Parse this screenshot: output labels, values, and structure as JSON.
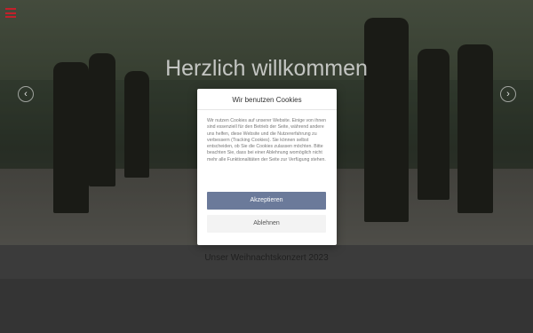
{
  "hero": {
    "title": "Herzlich willkommen",
    "prev_arrow": "‹",
    "next_arrow": "›"
  },
  "section": {
    "title": "Unser Weihnachtskonzert 2023"
  },
  "cookie_dialog": {
    "title": "Wir benutzen Cookies",
    "text": "Wir nutzen Cookies auf unserer Website. Einige von ihnen sind essenziell für den Betrieb der Seite, während andere uns helfen, diese Website und die Nutzererfahrung zu verbessern (Tracking Cookies). Sie können selbst entscheiden, ob Sie die Cookies zulassen möchten. Bitte beachten Sie, dass bei einer Ablehnung womöglich nicht mehr alle Funktionalitäten der Seite zur Verfügung stehen.",
    "accept_label": "Akzeptieren",
    "decline_label": "Ablehnen"
  },
  "colors": {
    "menu_icon": "#c4202b",
    "accept_button": "#6b7a9a"
  },
  "icons": {
    "menu": "hamburger-menu-icon"
  }
}
